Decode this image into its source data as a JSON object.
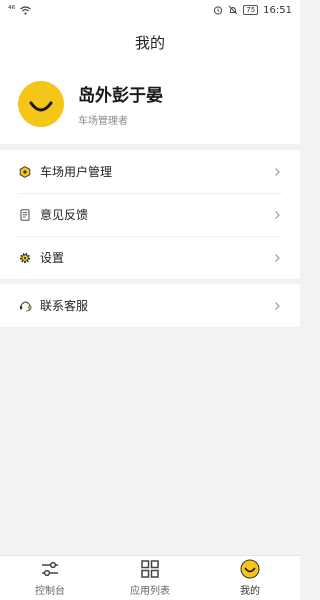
{
  "status_bar": {
    "signal": "⁴⁶",
    "time": "16:51",
    "battery": "75"
  },
  "header": {
    "title": "我的"
  },
  "profile": {
    "name": "岛外彭于晏",
    "role": "车场管理者"
  },
  "menu": {
    "items": [
      {
        "label": "车场用户管理",
        "icon": "user-management-icon"
      },
      {
        "label": "意见反馈",
        "icon": "feedback-icon"
      },
      {
        "label": "设置",
        "icon": "settings-icon"
      }
    ],
    "support": {
      "label": "联系客服",
      "icon": "headset-icon"
    }
  },
  "bottom_nav": {
    "items": [
      {
        "label": "控制台",
        "icon": "sliders-icon",
        "active": false
      },
      {
        "label": "应用列表",
        "icon": "grid-icon",
        "active": false
      },
      {
        "label": "我的",
        "icon": "smiley-icon",
        "active": true
      }
    ]
  },
  "colors": {
    "accent": "#f5c518",
    "background": "#f2f2f4"
  }
}
